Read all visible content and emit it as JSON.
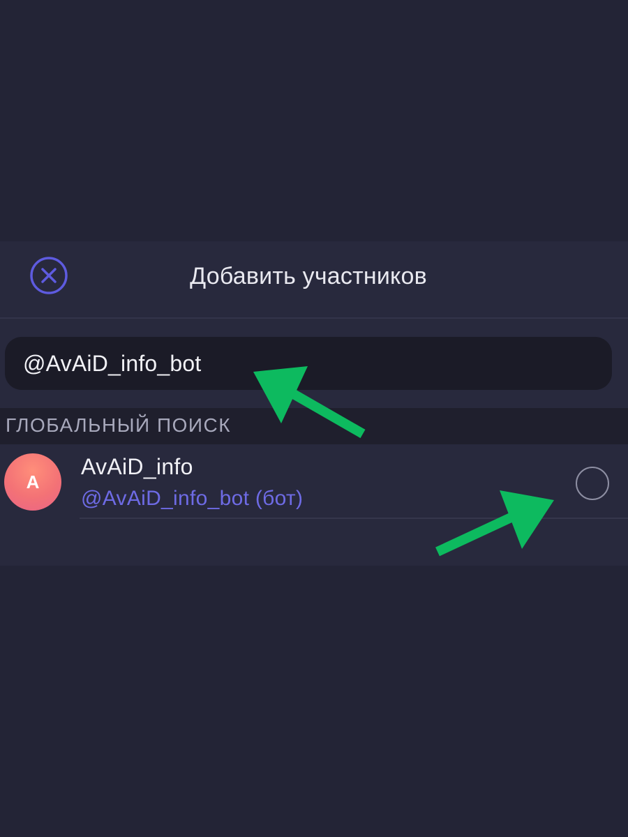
{
  "header": {
    "title": "Добавить участников",
    "close_icon": "close-circle-icon"
  },
  "search": {
    "value": "@AvAiD_info_bot"
  },
  "section": {
    "label": "ГЛОБАЛЬНЫЙ ПОИСК"
  },
  "results": [
    {
      "avatar_letter": "A",
      "name": "AvAiD_info",
      "username": "@AvAiD_info_bot (бот)",
      "selected": false
    }
  ],
  "annotations": {
    "arrow_color": "#0DBA5F",
    "arrow_icon": "arrow-annotation"
  },
  "colors": {
    "accent": "#5E5BE0",
    "background": "#232436",
    "panel": "#28293D"
  }
}
